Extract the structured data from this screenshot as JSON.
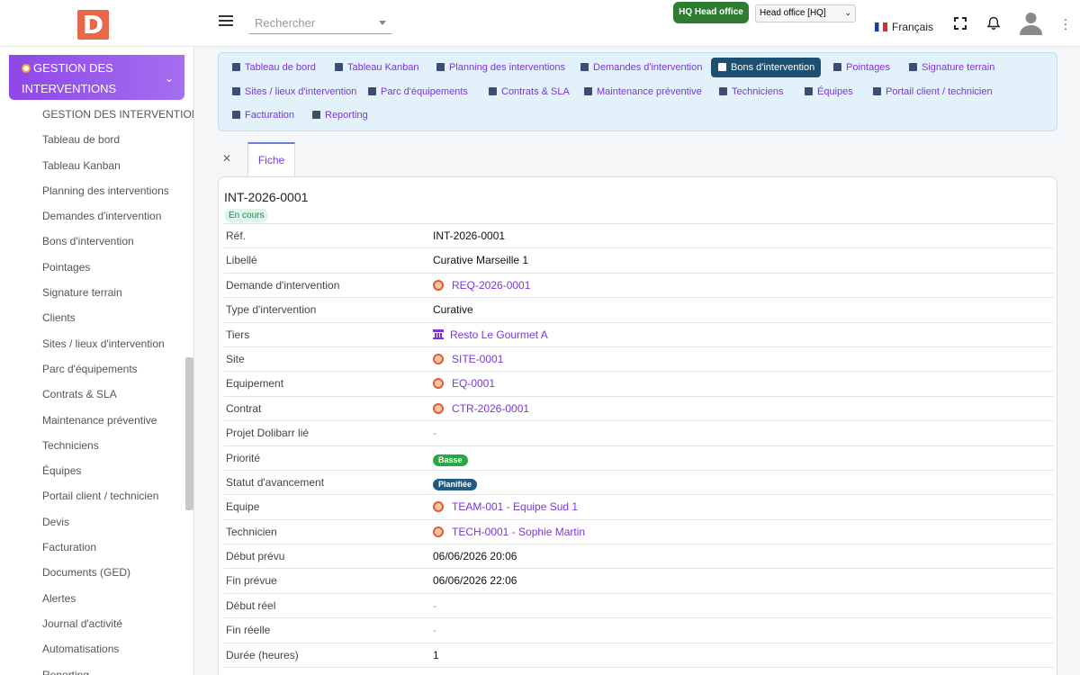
{
  "topbar": {
    "logo_letter": "D",
    "search_placeholder": "Rechercher",
    "entity_button": "HQ Head office",
    "entity_select": "Head office [HQ]",
    "language": "Français"
  },
  "sidebar": {
    "module_title_line1": "GESTION DES",
    "module_title_line2": "INTERVENTIONS",
    "items": [
      "GESTION DES INTERVENTIONS",
      "Tableau de bord",
      "Tableau Kanban",
      "Planning des interventions",
      "Demandes d'intervention",
      "Bons d'intervention",
      "Pointages",
      "Signature terrain",
      "Clients",
      "Sites / lieux d'intervention",
      "Parc d'équipements",
      "Contrats & SLA",
      "Maintenance préventive",
      "Techniciens",
      "Équipes",
      "Portail client / technicien",
      "Devis",
      "Facturation",
      "Documents (GED)",
      "Alertes",
      "Journal d'activité",
      "Automatisations",
      "Reporting"
    ]
  },
  "module_nav": {
    "items": [
      "Tableau de bord",
      "Tableau Kanban",
      "Planning des interventions",
      "Demandes d'intervention",
      "Bons d'intervention",
      "Pointages",
      "Signature terrain",
      "Sites / lieux d'intervention",
      "Parc d'équipements",
      "Contrats & SLA",
      "Maintenance préventive",
      "Techniciens",
      "Équipes",
      "Portail client / technicien",
      "Facturation",
      "Reporting"
    ],
    "active": "Bons d'intervention"
  },
  "tabs": {
    "fiche": "Fiche"
  },
  "record": {
    "title": "INT-2026-0001",
    "status": "En cours",
    "fields": [
      {
        "label": "Réf.",
        "value": "INT-2026-0001"
      },
      {
        "label": "Libellé",
        "value": "Curative Marseille 1"
      },
      {
        "label": "Demande d'intervention",
        "value": "REQ-2026-0001"
      },
      {
        "label": "Type d'intervention",
        "value": "Curative"
      },
      {
        "label": "Tiers",
        "value": "Resto Le Gourmet A"
      },
      {
        "label": "Site",
        "value": "SITE-0001"
      },
      {
        "label": "Equipement",
        "value": "EQ-0001"
      },
      {
        "label": "Contrat",
        "value": "CTR-2026-0001"
      },
      {
        "label": "Projet Dolibarr lié",
        "value": "-"
      },
      {
        "label": "Priorité",
        "value": "Basse"
      },
      {
        "label": "Statut d'avancement",
        "value": "Planifiée"
      },
      {
        "label": "Equipe",
        "value": "TEAM-001 - Equipe Sud 1"
      },
      {
        "label": "Technicien",
        "value": "TECH-0001 - Sophie Martin"
      },
      {
        "label": "Début prévu",
        "value": "06/06/2026 20:06"
      },
      {
        "label": "Fin prévue",
        "value": "06/06/2026 22:06"
      },
      {
        "label": "Début réel",
        "value": "-"
      },
      {
        "label": "Fin réelle",
        "value": "-"
      },
      {
        "label": "Durée (heures)",
        "value": "1"
      }
    ],
    "colors": {
      "priority_badge": "#28a745",
      "progress_badge": "#1d5a87"
    }
  }
}
